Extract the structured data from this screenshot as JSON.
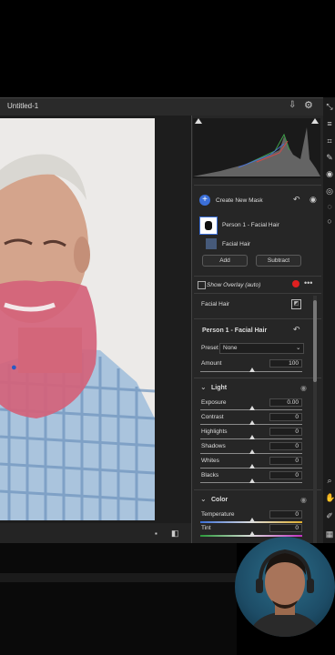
{
  "document": {
    "title": "Untitled-1"
  },
  "masks": {
    "create_label": "Create New Mask",
    "group_label": "Person 1 - Facial Hair",
    "item_label": "Facial Hair",
    "add_label": "Add",
    "subtract_label": "Subtract",
    "overlay_label": "Show Overlay (auto)"
  },
  "mask_header": {
    "label": "Facial Hair"
  },
  "adjust": {
    "title": "Person 1 - Facial Hair",
    "preset_label": "Preset",
    "preset_value": "None",
    "amount_label": "Amount",
    "amount_value": "100"
  },
  "light": {
    "title": "Light",
    "rows": [
      {
        "label": "Exposure",
        "value": "0.00"
      },
      {
        "label": "Contrast",
        "value": "0"
      },
      {
        "label": "Highlights",
        "value": "0"
      },
      {
        "label": "Shadows",
        "value": "0"
      },
      {
        "label": "Whites",
        "value": "0"
      },
      {
        "label": "Blacks",
        "value": "0"
      }
    ]
  },
  "color": {
    "title": "Color",
    "rows": [
      {
        "label": "Temperature",
        "value": "0"
      },
      {
        "label": "Tint",
        "value": "0"
      }
    ]
  },
  "colors": {
    "accent": "#3b6fd8",
    "mask_overlay": "#d4627a",
    "overlay_dot": "#e02020"
  }
}
